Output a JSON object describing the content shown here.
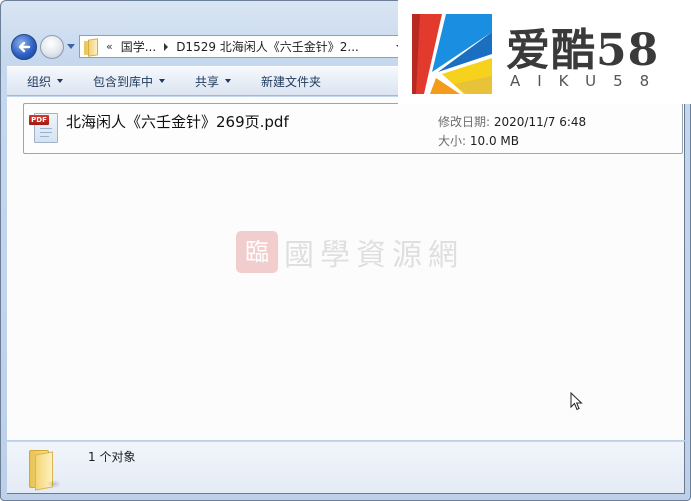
{
  "navigation": {
    "back_icon": "back-arrow-icon",
    "forward_icon": "forward-arrow-icon",
    "history_icon": "chevron-down-icon"
  },
  "address_bar": {
    "overflow_chevron": "«",
    "segments": [
      "国学...",
      "D1529 北海闲人《六壬金针》2..."
    ],
    "folder_icon": "folder-icon"
  },
  "toolbar": {
    "organize": "组织",
    "include_in_library": "包含到库中",
    "share": "共享",
    "new_folder": "新建文件夹"
  },
  "files": [
    {
      "name": "北海闲人《六壬金针》269页.pdf",
      "icon": "pdf-file-icon",
      "badge": "PDF",
      "modified_label": "修改日期:",
      "modified_value": "2020/11/7 6:48",
      "size_label": "大小:",
      "size_value": "10.0 MB"
    }
  ],
  "watermark": {
    "seal": "臨",
    "text": "國學資源網"
  },
  "status_bar": {
    "icon": "folder-icon",
    "text": "1 个对象"
  },
  "logo": {
    "title": "爱酷58",
    "subtitle": "AIKU58",
    "colors": {
      "red": "#e23b2e",
      "blue": "#1a8ee0",
      "dark_blue": "#1b6fc0",
      "yellow": "#f7d21c",
      "orange": "#f49b1b"
    }
  }
}
